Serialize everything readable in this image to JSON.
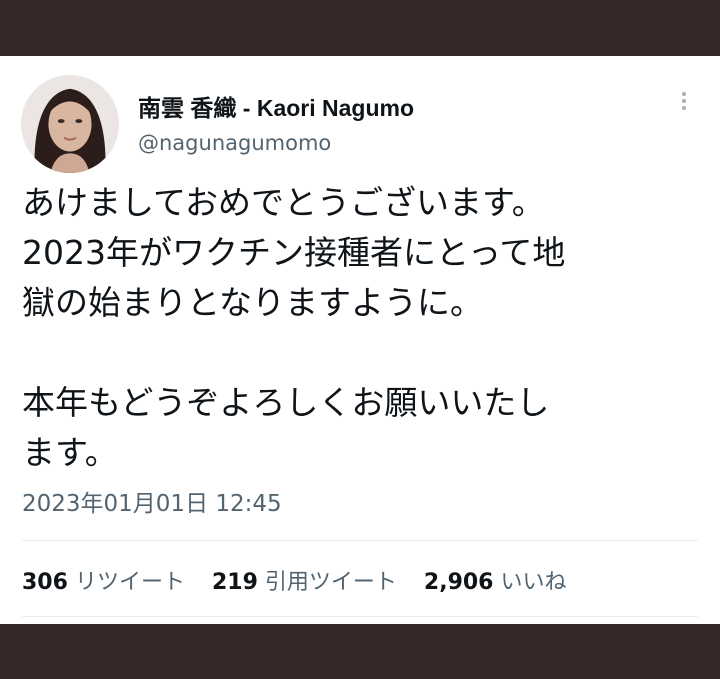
{
  "tweet": {
    "display_name": "南雲 香織 - Kaori Nagumo",
    "handle": "@nagunagumomo",
    "text": "あけましておめでとうございます。\n2023年がワクチン接種者にとって地\n獄の始まりとなりますように。\n\n本年もどうぞよろしくお願いいたし\nます。",
    "timestamp": "2023年01月01日 12:45",
    "stats": {
      "retweets_count": "306",
      "retweets_label": "リツイート",
      "quotes_count": "219",
      "quotes_label": "引用ツイート",
      "likes_count": "2,906",
      "likes_label": "いいね"
    }
  },
  "icons": {
    "more": "more-vertical-icon"
  },
  "colors": {
    "frame_bar": "#352a27",
    "primary_text": "#0f1419",
    "secondary_text": "#536471",
    "divider": "#e6ecf0"
  }
}
